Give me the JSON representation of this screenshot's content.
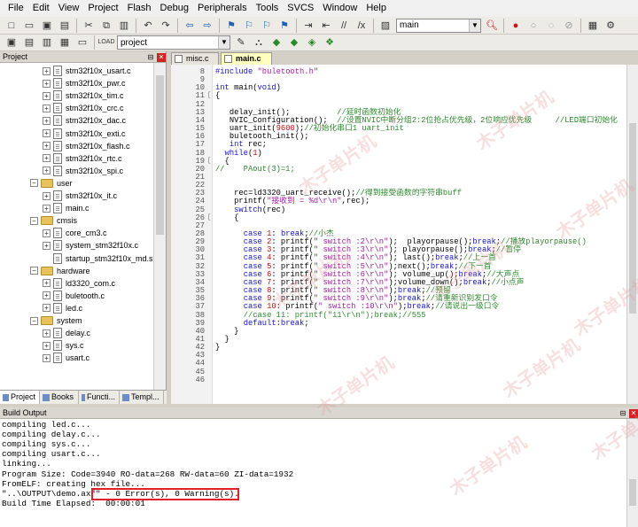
{
  "menu": [
    "File",
    "Edit",
    "View",
    "Project",
    "Flash",
    "Debug",
    "Peripherals",
    "Tools",
    "SVCS",
    "Window",
    "Help"
  ],
  "toolbar1": {
    "target_combo": "main"
  },
  "toolbar2": {
    "target_combo": "project"
  },
  "project_panel": {
    "title": "Project",
    "tree": [
      {
        "type": "file",
        "label": "stm32f10x_usart.c",
        "indent": 2
      },
      {
        "type": "file",
        "label": "stm32f10x_pwr.c",
        "indent": 2
      },
      {
        "type": "file",
        "label": "stm32f10x_tim.c",
        "indent": 2
      },
      {
        "type": "file",
        "label": "stm32f10x_crc.c",
        "indent": 2
      },
      {
        "type": "file",
        "label": "stm32f10x_dac.c",
        "indent": 2
      },
      {
        "type": "file",
        "label": "stm32f10x_exti.c",
        "indent": 2
      },
      {
        "type": "file",
        "label": "stm32f10x_flash.c",
        "indent": 2
      },
      {
        "type": "file",
        "label": "stm32f10x_rtc.c",
        "indent": 2
      },
      {
        "type": "file",
        "label": "stm32f10x_spi.c",
        "indent": 2
      },
      {
        "type": "folder",
        "label": "user",
        "indent": 1
      },
      {
        "type": "file",
        "label": "stm32f10x_it.c",
        "indent": 2
      },
      {
        "type": "file",
        "label": "main.c",
        "indent": 2
      },
      {
        "type": "folder",
        "label": "cmsis",
        "indent": 1
      },
      {
        "type": "file",
        "label": "core_cm3.c",
        "indent": 2
      },
      {
        "type": "file",
        "label": "system_stm32f10x.c",
        "indent": 2
      },
      {
        "type": "file-plain",
        "label": "startup_stm32f10x_md.s",
        "indent": 2
      },
      {
        "type": "folder",
        "label": "hardware",
        "indent": 1
      },
      {
        "type": "file",
        "label": "ld3320_com.c",
        "indent": 2
      },
      {
        "type": "file",
        "label": "buletooth.c",
        "indent": 2
      },
      {
        "type": "file",
        "label": "led.c",
        "indent": 2
      },
      {
        "type": "folder",
        "label": "system",
        "indent": 1
      },
      {
        "type": "file",
        "label": "delay.c",
        "indent": 2
      },
      {
        "type": "file",
        "label": "sys.c",
        "indent": 2
      },
      {
        "type": "file",
        "label": "usart.c",
        "indent": 2
      }
    ],
    "tabs": [
      "Project",
      "Books",
      "Functi...",
      "Templ..."
    ]
  },
  "editor": {
    "tabs": [
      {
        "label": "misc.c",
        "active": false
      },
      {
        "label": "main.c",
        "active": true
      }
    ],
    "lines": [
      {
        "n": "8",
        "fold": "",
        "html": "<span class=\"pp\">#include</span> <span class=\"str\">\"buletooth.h\"</span>"
      },
      {
        "n": "9",
        "fold": "",
        "html": ""
      },
      {
        "n": "10",
        "fold": "",
        "html": "<span class=\"kw\">int</span> main(<span class=\"kw\">void</span>)"
      },
      {
        "n": "11",
        "fold": "[",
        "html": "{"
      },
      {
        "n": "12",
        "fold": "",
        "html": ""
      },
      {
        "n": "13",
        "fold": "",
        "html": "   delay_init();          <span class=\"cm\">//延时函数初始化</span>"
      },
      {
        "n": "14",
        "fold": "",
        "html": "   NVIC_Configuration();  <span class=\"cm\">//设置NVIC中断分组2:2位抢占优先级，2位响应优先级     //LED端口初始化</span>"
      },
      {
        "n": "15",
        "fold": "",
        "html": "   uart_init(<span class=\"num\">9600</span>);<span class=\"cm\">//初始化串口1 uart_init</span>"
      },
      {
        "n": "16",
        "fold": "",
        "html": "   buletooth_init();"
      },
      {
        "n": "17",
        "fold": "",
        "html": "   <span class=\"kw\">int</span> rec;"
      },
      {
        "n": "18",
        "fold": "",
        "html": "  <span class=\"kw\">while</span>(<span class=\"num\">1</span>)"
      },
      {
        "n": "19",
        "fold": "[",
        "html": "  {"
      },
      {
        "n": "20",
        "fold": "",
        "html": "<span class=\"cm\">//    PAout(3)=1;</span>"
      },
      {
        "n": "21",
        "fold": "",
        "html": ""
      },
      {
        "n": "22",
        "fold": "",
        "html": ""
      },
      {
        "n": "23",
        "fold": "",
        "html": "    rec=ld3320_uart_receive();<span class=\"cm\">//得到接受函数的字符串buff</span>"
      },
      {
        "n": "24",
        "fold": "",
        "html": "    printf(<span class=\"str\">\"接收到 = %d\\r\\n\"</span>,rec);"
      },
      {
        "n": "25",
        "fold": "",
        "html": "    <span class=\"kw\">switch</span>(rec)"
      },
      {
        "n": "26",
        "fold": "[",
        "html": "    {"
      },
      {
        "n": "27",
        "fold": "",
        "html": ""
      },
      {
        "n": "28",
        "fold": "",
        "html": "      <span class=\"kw\">case</span> <span class=\"num\">1</span>: <span class=\"kw\">break</span>;<span class=\"cm\">//小杰</span>"
      },
      {
        "n": "29",
        "fold": "",
        "html": "      <span class=\"kw\">case</span> <span class=\"num\">2</span>: printf(<span class=\"str\">\" switch :2\\r\\n\"</span>);  playorpause();<span class=\"kw\">break</span>;<span class=\"cm\">//播放playorpause()</span>"
      },
      {
        "n": "30",
        "fold": "",
        "html": "      <span class=\"kw\">case</span> <span class=\"num\">3</span>: printf(<span class=\"str\">\" switch :3\\r\\n\"</span>); playorpause();<span class=\"kw\">break</span>;<span class=\"cm\">//暂停</span>"
      },
      {
        "n": "31",
        "fold": "",
        "html": "      <span class=\"kw\">case</span> <span class=\"num\">4</span>: printf(<span class=\"str\">\" switch :4\\r\\n\"</span>); last();<span class=\"kw\">break</span>;<span class=\"cm\">//上一首</span>"
      },
      {
        "n": "32",
        "fold": "",
        "html": "      <span class=\"kw\">case</span> <span class=\"num\">5</span>: printf(<span class=\"str\">\" switch :5\\r\\n\"</span>);next();<span class=\"kw\">break</span>;<span class=\"cm\">//下一首</span>"
      },
      {
        "n": "33",
        "fold": "",
        "html": "      <span class=\"kw\">case</span> <span class=\"num\">6</span>: printf(<span class=\"str\">\" switch :6\\r\\n\"</span>); volume_up();<span class=\"kw\">break</span>;<span class=\"cm\">//大声点</span>"
      },
      {
        "n": "34",
        "fold": "",
        "html": "      <span class=\"kw\">case</span> <span class=\"num\">7</span>: printf(<span class=\"str\">\" switch :7\\r\\n\"</span>);volume_down();<span class=\"kw\">break</span>;<span class=\"cm\">//小点声</span>"
      },
      {
        "n": "35",
        "fold": "",
        "html": "      <span class=\"kw\">case</span> <span class=\"num\">8</span>: printf(<span class=\"str\">\" switch :8\\r\\n\"</span>);<span class=\"kw\">break</span>;<span class=\"cm\">//预留</span>"
      },
      {
        "n": "36",
        "fold": "",
        "html": "      <span class=\"kw\">case</span> <span class=\"num\">9</span>: printf(<span class=\"str\">\" switch :9\\r\\n\"</span>);<span class=\"kw\">break</span>;<span class=\"cm\">//请重新识别发口令</span>"
      },
      {
        "n": "37",
        "fold": "",
        "html": "      <span class=\"kw\">case</span> <span class=\"num\">10</span>: printf(<span class=\"str\">\" switch :10\\r\\n\"</span>);<span class=\"kw\">break</span>;<span class=\"cm\">//请说出一级口令</span>"
      },
      {
        "n": "38",
        "fold": "",
        "html": "      <span class=\"cm\">//case 11: printf(\"11\\r\\n\");break;//555</span>"
      },
      {
        "n": "39",
        "fold": "",
        "html": "      <span class=\"kw\">default</span>:<span class=\"kw\">break</span>;"
      },
      {
        "n": "40",
        "fold": "",
        "html": "    }"
      },
      {
        "n": "41",
        "fold": "",
        "html": "  }"
      },
      {
        "n": "42",
        "fold": "",
        "html": "}"
      },
      {
        "n": "43",
        "fold": "",
        "html": ""
      },
      {
        "n": "44",
        "fold": "",
        "html": ""
      },
      {
        "n": "45",
        "fold": "",
        "html": ""
      },
      {
        "n": "46",
        "fold": "",
        "html": ""
      }
    ]
  },
  "build_output": {
    "title": "Build Output",
    "lines": [
      "compiling led.c...",
      "compiling delay.c...",
      "compiling sys.c...",
      "compiling usart.c...",
      "linking...",
      "Program Size: Code=3940 RO-data=268 RW-data=60 ZI-data=1932",
      "FromELF: creating hex file...",
      "\"..\\OUTPUT\\demo.axf\" - 0 Error(s), 0 Warning(s).",
      "Build Time Elapsed:  00:00:01"
    ]
  },
  "watermark_text": "木子单片机"
}
